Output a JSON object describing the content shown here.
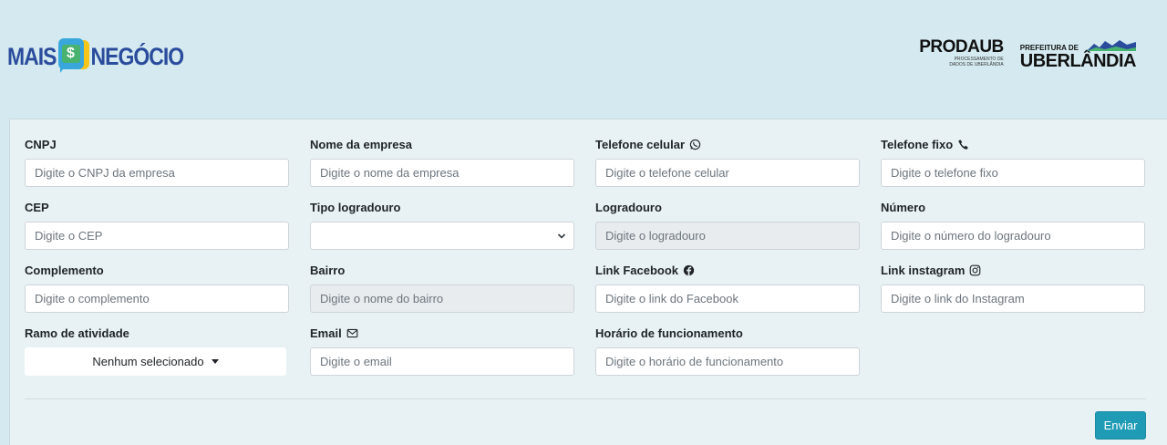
{
  "header": {
    "logo_left_a": "MAIS",
    "logo_left_coin": "$",
    "logo_left_b": "NEGÓCIO",
    "prodaub_big": "PRODAUB",
    "prodaub_small": "PROCESSAMENTO DE DADOS DE UBERLÂNDIA",
    "udi_top": "PREFEITURA DE",
    "udi_big": "UBERLÂNDIA"
  },
  "form": {
    "cnpj": {
      "label": "CNPJ",
      "placeholder": "Digite o CNPJ da empresa"
    },
    "nome_empresa": {
      "label": "Nome da empresa",
      "placeholder": "Digite o nome da empresa"
    },
    "telefone_celular": {
      "label": "Telefone celular",
      "placeholder": "Digite o telefone celular"
    },
    "telefone_fixo": {
      "label": "Telefone fixo",
      "placeholder": "Digite o telefone fixo"
    },
    "cep": {
      "label": "CEP",
      "placeholder": "Digite o CEP"
    },
    "tipo_logradouro": {
      "label": "Tipo logradouro",
      "value": ""
    },
    "logradouro": {
      "label": "Logradouro",
      "placeholder": "Digite o logradouro"
    },
    "numero": {
      "label": "Número",
      "placeholder": "Digite o número do logradouro"
    },
    "complemento": {
      "label": "Complemento",
      "placeholder": "Digite o complemento"
    },
    "bairro": {
      "label": "Bairro",
      "placeholder": "Digite o nome do bairro"
    },
    "link_facebook": {
      "label": "Link Facebook",
      "placeholder": "Digite o link do Facebook"
    },
    "link_instagram": {
      "label": "Link instagram",
      "placeholder": "Digite o link do Instagram"
    },
    "ramo_atividade": {
      "label": "Ramo de atividade",
      "selected": "Nenhum selecionado"
    },
    "email": {
      "label": "Email",
      "placeholder": "Digite o email"
    },
    "horario": {
      "label": "Horário de funcionamento",
      "placeholder": "Digite o horário de funcionamento"
    },
    "submit_label": "Enviar"
  },
  "colors": {
    "page_bg": "#d4eaf0",
    "card_bg": "#e8f2f4",
    "button": "#1f9bb5",
    "logo_blue": "#2b4c9c"
  },
  "icons": {
    "telefone_celular": "whatsapp-icon",
    "telefone_fixo": "phone-icon",
    "link_facebook": "facebook-icon",
    "link_instagram": "instagram-icon",
    "email": "envelope-icon"
  }
}
